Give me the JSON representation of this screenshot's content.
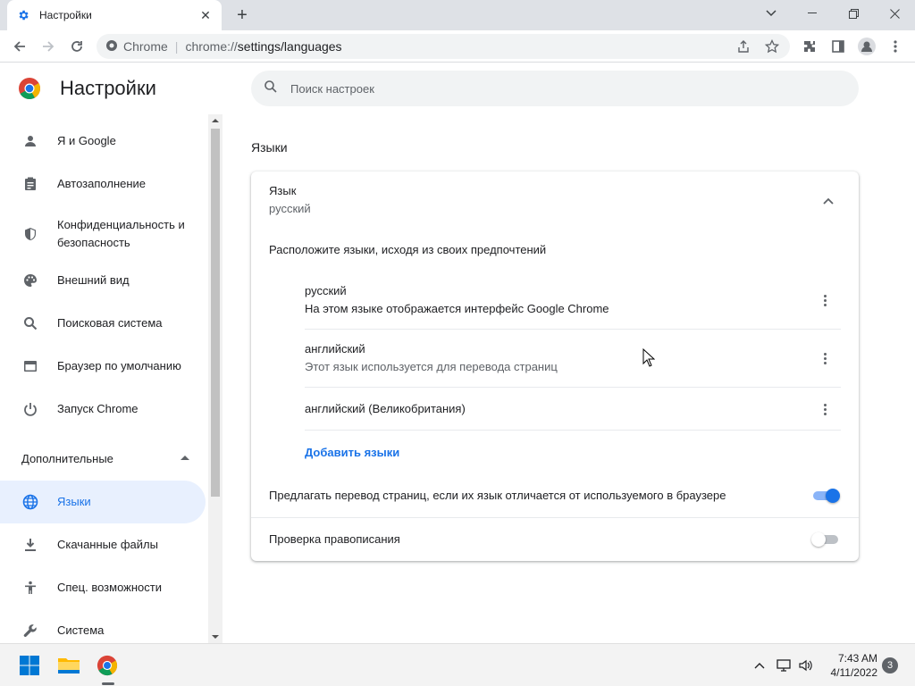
{
  "browser": {
    "tab_title": "Настройки",
    "site_label": "Chrome",
    "url_scheme": "chrome://",
    "url_path": "settings/languages"
  },
  "settings": {
    "title": "Настройки",
    "search_placeholder": "Поиск настроек"
  },
  "sidebar": {
    "items": [
      {
        "label": "Я и Google",
        "icon": "person-icon"
      },
      {
        "label": "Автозаполнение",
        "icon": "clipboard-icon"
      },
      {
        "label": "Конфиденциальность и безопасность",
        "icon": "shield-icon"
      },
      {
        "label": "Внешний вид",
        "icon": "palette-icon"
      },
      {
        "label": "Поисковая система",
        "icon": "search-icon"
      },
      {
        "label": "Браузер по умолчанию",
        "icon": "browser-window-icon"
      },
      {
        "label": "Запуск Chrome",
        "icon": "power-icon"
      }
    ],
    "advanced_label": "Дополнительные",
    "advanced_items": [
      {
        "label": "Языки",
        "icon": "globe-icon",
        "active": true
      },
      {
        "label": "Скачанные файлы",
        "icon": "download-icon"
      },
      {
        "label": "Спец. возможности",
        "icon": "accessibility-icon"
      },
      {
        "label": "Система",
        "icon": "wrench-icon"
      }
    ]
  },
  "main": {
    "section_title": "Языки",
    "language_label": "Язык",
    "language_value": "русский",
    "order_hint": "Расположите языки, исходя из своих предпочтений",
    "languages": [
      {
        "name": "русский",
        "note": "На этом языке отображается интерфейс Google Chrome"
      },
      {
        "name": "английский",
        "note": "Этот язык используется для перевода страниц"
      },
      {
        "name": "английский (Великобритания)",
        "note": ""
      }
    ],
    "add_languages": "Добавить языки",
    "offer_translate_label": "Предлагать перевод страниц, если их язык отличается от используемого в браузере",
    "offer_translate_on": true,
    "spellcheck_label": "Проверка правописания",
    "spellcheck_on": false
  },
  "taskbar": {
    "time": "7:43 AM",
    "date": "4/11/2022",
    "notification_count": "3"
  },
  "colors": {
    "accent": "#1a73e8",
    "active_bg": "#e8f0fe"
  }
}
